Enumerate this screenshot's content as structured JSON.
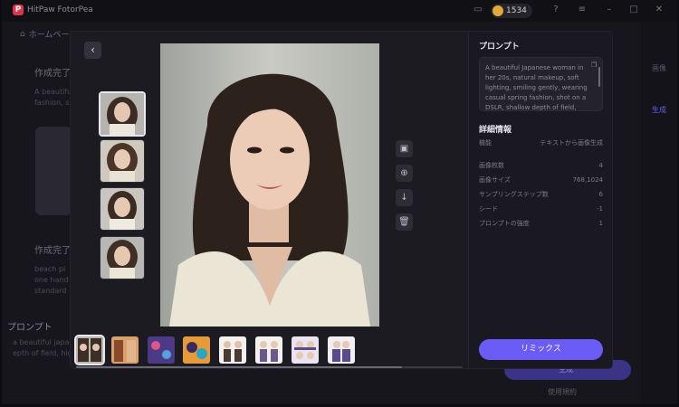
{
  "app": {
    "title": "HitPaw FotorPea",
    "credits": "1534"
  },
  "background": {
    "breadcrumb": "ホームページ",
    "card1_title": "作成完了",
    "card1_text": [
      "A beautiful",
      "fashion, s"
    ],
    "card2_title": "作成完了",
    "card2_text": [
      "beach pi",
      "one hand",
      "standard"
    ],
    "left_prompt_title": "プロンプト",
    "left_prompt_text": [
      "a beautiful japan",
      "epth of field, hig"
    ],
    "rail": [
      "画像",
      "生成"
    ],
    "generate_label": "生成",
    "footer_note": "使用規約"
  },
  "modal": {
    "prompt_title": "プロンプト",
    "prompt_text": "A beautiful Japanese woman in her 20s, natural makeup, soft lighting, smiling gently, wearing casual spring fashion, shot on a DSLR, shallow depth of field, highly realistic, ultra-detailed skin texture, photorealistic",
    "details_title": "詳細情報",
    "details": [
      {
        "label": "機能",
        "value": "テキストから画像生成"
      },
      {
        "label": "画像枚数",
        "value": "4"
      },
      {
        "label": "画像サイズ",
        "value": "768,1024"
      },
      {
        "label": "サンプリングステップ数",
        "value": "6"
      },
      {
        "label": "シード",
        "value": "-1"
      },
      {
        "label": "プロンプトの強度",
        "value": "1"
      }
    ],
    "remix_label": "リミックス",
    "tools": [
      "image-icon",
      "zoom-icon",
      "download-icon",
      "trash-icon"
    ]
  },
  "colors": {
    "accent": "#6b5cf5",
    "background": "#1a1921"
  }
}
